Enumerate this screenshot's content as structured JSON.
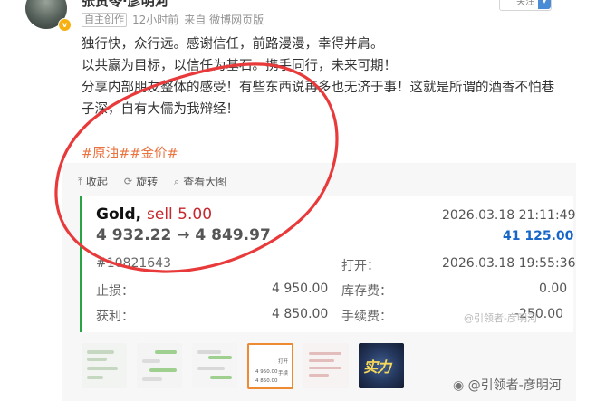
{
  "author": {
    "name": "张贵苓·彦明河",
    "edited_tag": "自主创作",
    "time": "12小时前",
    "source": "来自 微博网页版",
    "follow_label": "关注"
  },
  "post": {
    "lines": [
      "独行快，众行远。感谢信任，前路漫漫，幸得并肩。",
      "以共赢为目标，以信任为基石。携手同行，未来可期！",
      "分享内部朋友整体的感受！有些东西说再多也无济于事！这就是所谓的酒香不怕巷",
      "子深，自有大儒为我辩经！"
    ],
    "hashtags": [
      "#原油#",
      "#金价#"
    ]
  },
  "toolbar": {
    "collapse": "收起",
    "rotate": "旋转",
    "view_large": "查看大图"
  },
  "trade": {
    "symbol": "Gold,",
    "side": "sell 5.00",
    "prices": "4 932.22 → 4 849.97",
    "close_time": "2026.03.18 21:11:49",
    "profit": "41 125.00",
    "order_id": "#10821643",
    "open_label": "打开：",
    "open_time": "2026.03.18 19:55:36",
    "sl_label": "止损：",
    "sl_value": "4 950.00",
    "swap_label": "库存费：",
    "swap_value": "0.00",
    "tp_label": "获利：",
    "tp_value": "4 850.00",
    "fee_label": "手续费：",
    "fee_value": "-250.00"
  },
  "watermark_small": "@引领者-彦明河",
  "thumbnail4": {
    "open_label": "打开",
    "fee_label": "手续",
    "price1": "4 950.00",
    "price2": "4 850.00"
  },
  "thumbnail6_text": "实力",
  "watermark_big": "@引领者-彦明河",
  "colors": {
    "hashtag": "#eb7340",
    "sell": "#c7282d",
    "profit": "#1766c8",
    "annotation_oval": "#e83a3a"
  }
}
